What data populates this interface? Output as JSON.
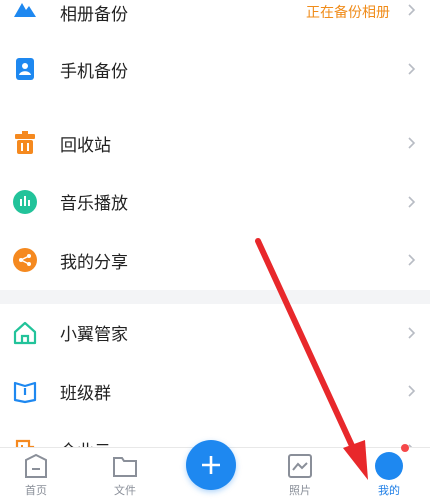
{
  "menu": {
    "items": [
      {
        "label": "相册备份",
        "value": "正在备份相册"
      },
      {
        "label": "手机备份"
      },
      {
        "label": "回收站"
      },
      {
        "label": "音乐播放"
      },
      {
        "label": "我的分享"
      },
      {
        "label": "小翼管家"
      },
      {
        "label": "班级群"
      },
      {
        "label": "企业云"
      }
    ]
  },
  "tabbar": {
    "tabs": [
      {
        "label": "首页"
      },
      {
        "label": "文件"
      },
      {
        "label": "照片"
      },
      {
        "label": "我的"
      }
    ]
  },
  "colors": {
    "accent": "#1e88f0",
    "highlight_text": "#f08c1a",
    "arrow": "#e8282b",
    "badge": "#f5484a"
  },
  "icons": [
    "mountain-icon",
    "phone-icon",
    "trash-icon",
    "music-icon",
    "share-icon",
    "home-icon",
    "book-icon",
    "building-icon",
    "plus-icon",
    "photo-icon",
    "file-icon",
    "avatar"
  ]
}
